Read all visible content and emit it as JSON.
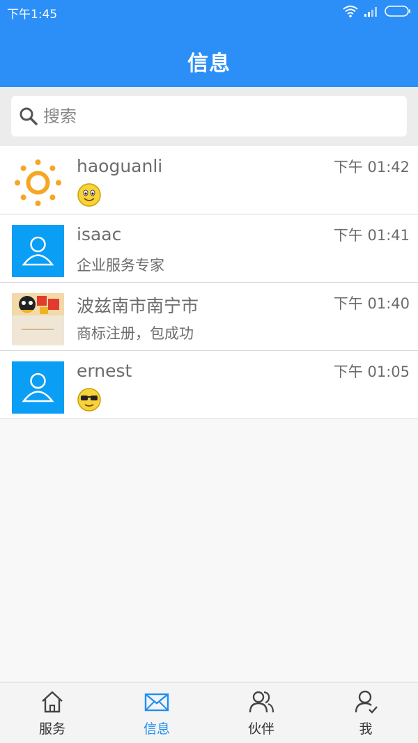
{
  "status_bar": {
    "time": "下午1:45"
  },
  "header": {
    "title": "信息"
  },
  "search": {
    "placeholder": "搜索"
  },
  "conversations": [
    {
      "name": "haoguanli",
      "time": "下午 01:42",
      "preview": "",
      "avatar": "sun-icon",
      "preview_icon": "smile-emoji-icon"
    },
    {
      "name": "isaac",
      "time": "下午 01:41",
      "preview": "企业服务专家",
      "avatar": "default-user-avatar"
    },
    {
      "name": "波兹南市南宁市",
      "time": "下午 01:40",
      "preview": "商标注册，包成功",
      "avatar": "photo-avatar"
    },
    {
      "name": "ernest",
      "time": "下午 01:05",
      "preview": "",
      "avatar": "default-user-avatar",
      "preview_icon": "sunglasses-emoji-icon"
    }
  ],
  "tabs": [
    {
      "label": "服务",
      "icon": "home-icon",
      "active": false
    },
    {
      "label": "信息",
      "icon": "mail-icon",
      "active": true
    },
    {
      "label": "伙伴",
      "icon": "partners-icon",
      "active": false
    },
    {
      "label": "我",
      "icon": "profile-icon",
      "active": false
    }
  ],
  "colors": {
    "header": "#2b8ff7",
    "accent": "#1f8ef2",
    "avatar_bg": "#0b9ef5"
  }
}
